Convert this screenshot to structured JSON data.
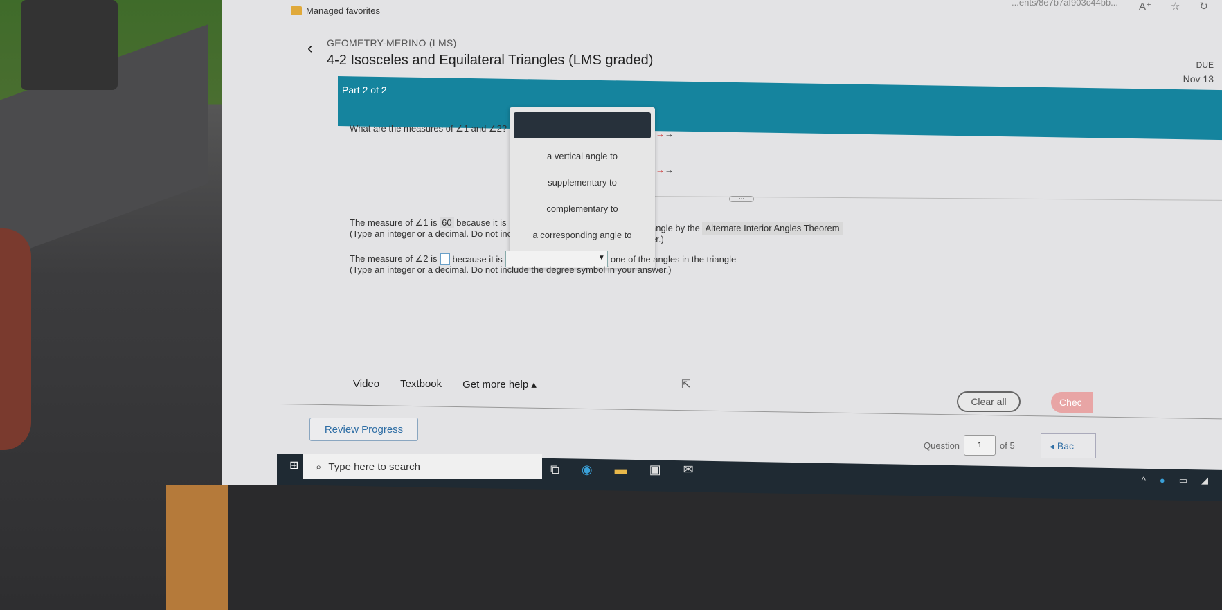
{
  "browser": {
    "favorites_label": "Managed favorites",
    "url_fragment": "...ents/8e7b7af903c44bb..."
  },
  "header": {
    "course": "GEOMETRY-MERINO (LMS)",
    "title": "4-2 Isosceles and Equilateral Triangles (LMS graded)",
    "due_label": "DUE",
    "due_date": "Nov 13"
  },
  "part": {
    "label": "Part 2 of 2"
  },
  "question": {
    "prompt": "What are the measures of ∠1 and ∠2?"
  },
  "answer1": {
    "prefix": "The measure of ∠1 is",
    "value": "60",
    "suffix": "because it is",
    "tail": "angle by the",
    "theorem": "Alternate Interior Angles Theorem",
    "hint": "(Type an integer or a decimal. Do not inc",
    "hint_tail": "er.)"
  },
  "dropdown": {
    "options": [
      "a vertical angle to",
      "supplementary to",
      "complementary to",
      "a corresponding angle to"
    ]
  },
  "answer2": {
    "prefix": "The measure of ∠2 is",
    "value": "",
    "middle": "because it is",
    "selected": "",
    "suffix": "one of the angles in the triangle",
    "hint": "(Type an integer or a decimal. Do not include the degree symbol in your answer.)"
  },
  "tools": {
    "video": "Video",
    "textbook": "Textbook",
    "help": "Get more help ▴"
  },
  "actions": {
    "clear_all": "Clear all",
    "check": "Chec",
    "review": "Review Progress",
    "back": "◂ Bac"
  },
  "nav": {
    "question_label": "Question",
    "current": "1",
    "of_label": "of 5"
  },
  "taskbar": {
    "search_placeholder": "Type here to search"
  },
  "colors": {
    "banner": "#15849e",
    "accent_blue": "#2f6ea5",
    "check_button": "#e8a5a5"
  }
}
